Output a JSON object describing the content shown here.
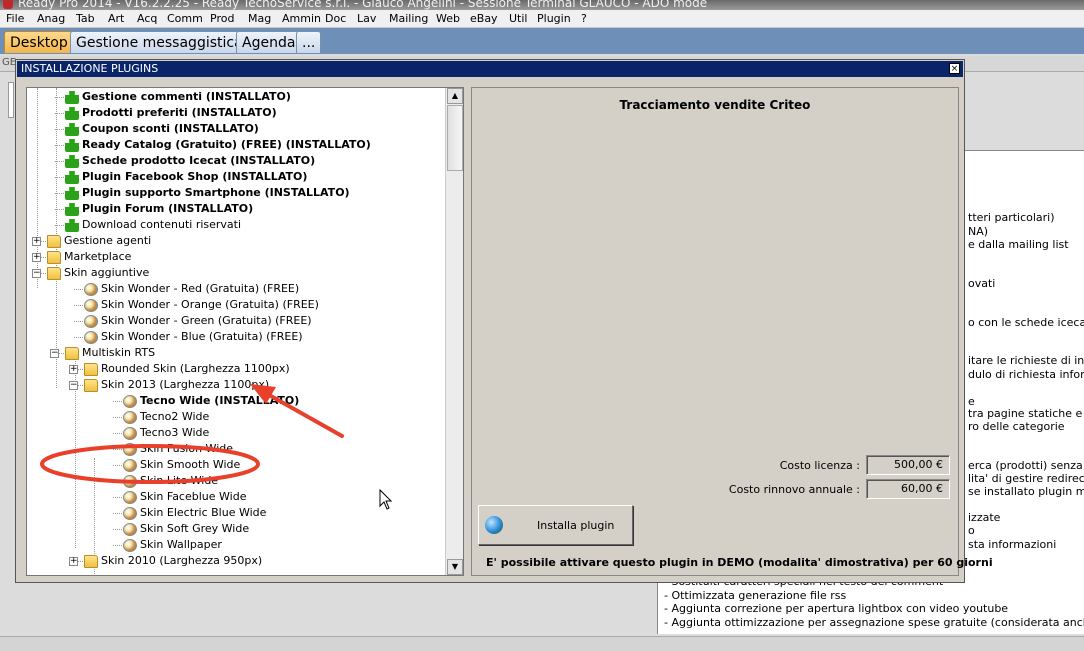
{
  "window": {
    "title": "Ready Pro 2014 - V16.2.2.25 - Ready TecnoService s.r.l. - Glauco Angelini - Sessione Terminal GLAUCO - ADO mode"
  },
  "menu": [
    "File",
    "Anag",
    "Tab",
    "Art",
    "Acq",
    "Comm",
    "Prod",
    "Mag",
    "Ammin",
    "Doc",
    "Lav",
    "Mailing",
    "Web",
    "eBay",
    "Util",
    "Plugin",
    "?"
  ],
  "tabs": [
    {
      "label": "Desktop",
      "active": true
    },
    {
      "label": "Gestione messaggistica",
      "active": false
    },
    {
      "label": "Agenda",
      "active": false
    },
    {
      "label": "...",
      "active": false
    }
  ],
  "background": {
    "strip_label": "GE",
    "panel_lines": [
      "tteri particolari)",
      "NA)",
      "e dalla mailing list",
      "ovati",
      "o con le schede icecat",
      "itare le richieste di inform",
      "dulo di richiesta informazi",
      "e",
      "tra pagine statiche e con",
      "ro delle categorie",
      "erca (prodotti) senza risu",
      "lita' di gestire redirect su",
      "se installato plugin mobile",
      "izzate",
      "o",
      "sta informazioni"
    ],
    "list_lines": [
      "- Sostituiti caratteri speciali nel testo del comment",
      "- Ottimizzata generazione file rss",
      "- Aggiunta correzione per apertura lightbox con video youtube",
      "- Aggiunta ottimizzazione per assegnazione spese gratuite (considerata anche la destina"
    ]
  },
  "dialog": {
    "title": "INSTALLAZIONE PLUGINS",
    "close_symbol": "×",
    "tree": [
      {
        "label": "Gestione commenti (INSTALLATO)",
        "icon": "plugin-icon",
        "bold": true,
        "level": 1
      },
      {
        "label": "Prodotti preferiti (INSTALLATO)",
        "icon": "plugin-icon",
        "bold": true,
        "level": 1
      },
      {
        "label": "Coupon sconti (INSTALLATO)",
        "icon": "plugin-icon",
        "bold": true,
        "level": 1
      },
      {
        "label": "Ready Catalog (Gratuito) (FREE) (INSTALLATO)",
        "icon": "plugin-icon",
        "bold": true,
        "level": 1
      },
      {
        "label": "Schede prodotto Icecat (INSTALLATO)",
        "icon": "plugin-icon",
        "bold": true,
        "level": 1
      },
      {
        "label": "Plugin Facebook Shop (INSTALLATO)",
        "icon": "plugin-icon",
        "bold": true,
        "level": 1
      },
      {
        "label": "Plugin supporto Smartphone (INSTALLATO)",
        "icon": "plugin-icon",
        "bold": true,
        "level": 1
      },
      {
        "label": "Plugin Forum (INSTALLATO)",
        "icon": "plugin-icon",
        "bold": true,
        "level": 1
      },
      {
        "label": "Download contenuti riservati",
        "icon": "plugin-doc-icon",
        "bold": false,
        "level": 1
      },
      {
        "label": "Gestione agenti",
        "icon": "folder-icon",
        "bold": false,
        "level": 0,
        "expander": "+"
      },
      {
        "label": "Marketplace",
        "icon": "folder-icon",
        "bold": false,
        "level": 0,
        "expander": "+"
      },
      {
        "label": "Skin aggiuntive",
        "icon": "folder-icon",
        "bold": false,
        "level": 0,
        "expander": "−"
      },
      {
        "label": "Skin Wonder - Red (Gratuita) (FREE)",
        "icon": "skin-icon",
        "bold": false,
        "level": 2
      },
      {
        "label": "Skin Wonder - Orange (Gratuita) (FREE)",
        "icon": "skin-icon",
        "bold": false,
        "level": 2
      },
      {
        "label": "Skin Wonder - Green (Gratuita) (FREE)",
        "icon": "skin-icon",
        "bold": false,
        "level": 2
      },
      {
        "label": "Skin Wonder - Blue (Gratuita) (FREE)",
        "icon": "skin-icon",
        "bold": false,
        "level": 2
      },
      {
        "label": "Multiskin RTS",
        "icon": "folder-icon",
        "bold": false,
        "level": 1,
        "expander": "−"
      },
      {
        "label": "Rounded Skin (Larghezza 1100px)",
        "icon": "folder-icon",
        "bold": false,
        "level": 2,
        "expander": "+"
      },
      {
        "label": "Skin 2013 (Larghezza 1100px)",
        "icon": "folder-icon",
        "bold": false,
        "level": 2,
        "expander": "−"
      },
      {
        "label": "Tecno Wide (INSTALLATO)",
        "icon": "skin-icon",
        "bold": true,
        "level": 4
      },
      {
        "label": "Tecno2 Wide",
        "icon": "skin-icon",
        "bold": false,
        "level": 4
      },
      {
        "label": "Tecno3 Wide",
        "icon": "skin-icon",
        "bold": false,
        "level": 4
      },
      {
        "label": "Skin Fusion Wide",
        "icon": "skin-icon",
        "bold": false,
        "level": 4
      },
      {
        "label": "Skin Smooth Wide",
        "icon": "skin-icon",
        "bold": false,
        "level": 4
      },
      {
        "label": "Skin Lite Wide",
        "icon": "skin-icon",
        "bold": false,
        "level": 4
      },
      {
        "label": "Skin Faceblue Wide",
        "icon": "skin-icon",
        "bold": false,
        "level": 4
      },
      {
        "label": "Skin Electric Blue Wide",
        "icon": "skin-icon",
        "bold": false,
        "level": 4
      },
      {
        "label": "Skin Soft Grey Wide",
        "icon": "skin-icon",
        "bold": false,
        "level": 4
      },
      {
        "label": "Skin Wallpaper",
        "icon": "skin-icon",
        "bold": false,
        "level": 4
      },
      {
        "label": "Skin 2010 (Larghezza 950px)",
        "icon": "folder-icon",
        "bold": false,
        "level": 2,
        "expander": "+"
      }
    ],
    "detail": {
      "plugin_title": "Tracciamento vendite Criteo",
      "license_label": "Costo licenza :",
      "license_value": "500,00 €",
      "renewal_label": "Costo rinnovo annuale :",
      "renewal_value": "60,00 €",
      "install_label": "Installa plugin",
      "demo_note": "E' possibile attivare questo plugin in DEMO (modalita' dimostrativa) per 60 giorni"
    }
  },
  "colors": {
    "annotation": "#e8402a",
    "tab_active": "#f3b64b",
    "dialog_title": "#0a246a"
  }
}
